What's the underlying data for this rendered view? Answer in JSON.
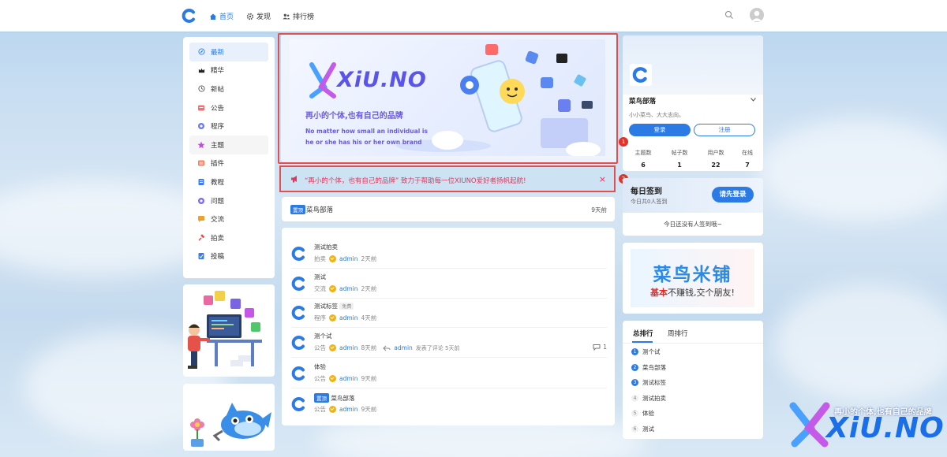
{
  "colors": {
    "accent": "#2c7be5",
    "danger": "#e05050",
    "notice_text": "#e0375c"
  },
  "nav": {
    "home": "首页",
    "discover": "发现",
    "ranking": "排行榜"
  },
  "sidebar": {
    "items": [
      {
        "label": "最新",
        "icon": "compass-icon"
      },
      {
        "label": "精华",
        "icon": "crown-icon"
      },
      {
        "label": "新帖",
        "icon": "clock-icon"
      },
      {
        "label": "公告",
        "icon": "announcement-icon"
      },
      {
        "label": "程序",
        "icon": "program-icon"
      },
      {
        "label": "主题",
        "icon": "theme-icon"
      },
      {
        "label": "插件",
        "icon": "plugin-icon"
      },
      {
        "label": "教程",
        "icon": "tutorial-icon"
      },
      {
        "label": "问题",
        "icon": "question-icon"
      },
      {
        "label": "交流",
        "icon": "chat-icon"
      },
      {
        "label": "拍卖",
        "icon": "auction-icon"
      },
      {
        "label": "投稿",
        "icon": "submit-icon"
      }
    ]
  },
  "banner": {
    "brand": "XiU.NO",
    "slogan": "再小的个体,也有自己的品牌",
    "english_line1": "No matter how small an individual is",
    "english_line2": "he or she has his or her own brand"
  },
  "notice": {
    "text": "“再小的个体，也有自己的品牌” 致力于帮助每一位XIUNO爱好者扬帆起航!",
    "close": "×"
  },
  "pinned": {
    "tag": "置顶",
    "title": "菜鸟部落",
    "time": "9天前"
  },
  "posts": [
    {
      "title": "测试拍卖",
      "category": "拍卖",
      "user": "admin",
      "time": "2天前"
    },
    {
      "title": "测试",
      "category": "交流",
      "user": "admin",
      "time": "2天前"
    },
    {
      "title": "测试标签",
      "title_tag": "免费",
      "category": "程序",
      "user": "admin",
      "time": "4天前"
    },
    {
      "title": "测个试",
      "category": "公告",
      "user": "admin",
      "time": "8天前",
      "reply_user": "admin",
      "reply_text": "发表了评论 5天前",
      "comments": "1"
    },
    {
      "title": "体验",
      "category": "公告",
      "user": "admin",
      "time": "9天前"
    },
    {
      "title_tag_prefix": "置顶",
      "title": "菜鸟部落",
      "category": "公告",
      "user": "admin",
      "time": "9天前"
    }
  ],
  "site": {
    "name": "菜鸟部落",
    "desc": "小小菜鸟、大大志向。",
    "login": "登录",
    "register": "注册",
    "stats": [
      {
        "label": "主题数",
        "value": "6"
      },
      {
        "label": "帖子数",
        "value": "1"
      },
      {
        "label": "用户数",
        "value": "22"
      },
      {
        "label": "在线",
        "value": "7"
      }
    ]
  },
  "signin": {
    "title": "每日签到",
    "subtitle": "今日共0人签到",
    "button": "请先登录",
    "empty": "今日还没有人签到哦~"
  },
  "ad": {
    "title": "菜鸟米铺",
    "line_red": "基本",
    "line_rest": "不赚钱,交个朋友!"
  },
  "rank": {
    "tab_total": "总排行",
    "tab_week": "周排行",
    "items": [
      {
        "no": "1",
        "title": "测个试"
      },
      {
        "no": "2",
        "title": "菜鸟部落"
      },
      {
        "no": "3",
        "title": "测试标签"
      },
      {
        "no": "4",
        "title": "测试拍卖"
      },
      {
        "no": "5",
        "title": "体验"
      },
      {
        "no": "6",
        "title": "测试"
      }
    ]
  },
  "annotations": {
    "one": "1",
    "two": "2"
  },
  "watermark": {
    "brand": "XiU.NO",
    "slogan": "再小的个体,也有自己的品牌"
  }
}
